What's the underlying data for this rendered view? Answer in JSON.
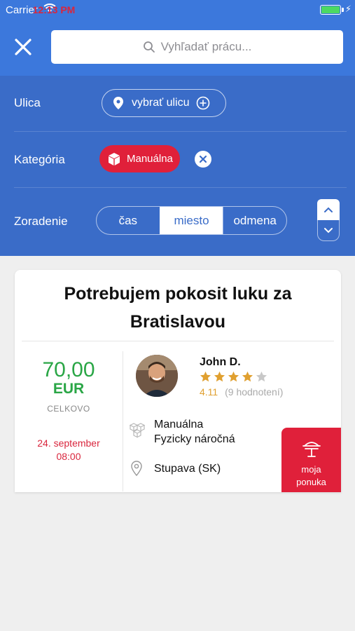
{
  "status_bar": {
    "carrier": "Carrier",
    "time": "12:13 PM"
  },
  "search": {
    "placeholder": "Vyhľadať prácu..."
  },
  "filters": {
    "street": {
      "label": "Ulica",
      "button": "vybrať ulicu"
    },
    "category": {
      "label": "Kategória",
      "selected": "Manuálna"
    },
    "sort": {
      "label": "Zoradenie",
      "options": [
        "čas",
        "miesto",
        "odmena"
      ],
      "active_index": 1
    }
  },
  "job": {
    "title": "Potrebujem pokosit luku za Bratislavou",
    "price": "70,00",
    "currency": "EUR",
    "price_note": "CELKOVO",
    "date": "24. september",
    "time": "08:00",
    "user": {
      "name": "John D.",
      "rating": "4.11",
      "rating_count": "(9 hodnotení)",
      "stars_filled": 4,
      "stars_total": 5
    },
    "category": "Manuálna",
    "difficulty": "Fyzicky náročná",
    "location": "Stupava (SK)",
    "offer_button": {
      "line1": "moja",
      "line2": "ponuka"
    }
  },
  "colors": {
    "header": "#3c78dc",
    "panel": "#3a6cc8",
    "accent_red": "#e0203a",
    "price_green": "#2aa646",
    "star": "#e0a030"
  }
}
